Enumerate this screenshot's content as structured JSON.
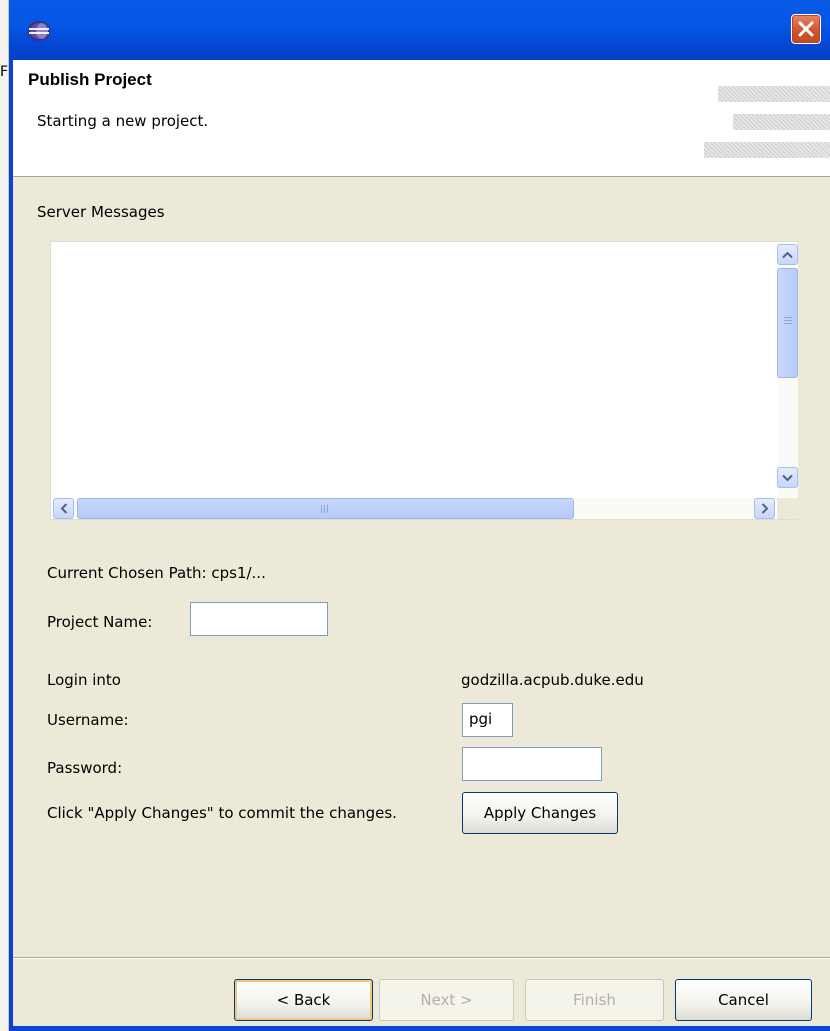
{
  "background_fragment": "F",
  "dialog": {
    "header": {
      "title": "Publish Project",
      "description": "Starting a new project."
    },
    "server_messages_label": "Server Messages",
    "server_messages_content": "",
    "current_path_label": "Current Chosen Path: cps1/...",
    "project_name": {
      "label": "Project Name:",
      "value": ""
    },
    "login": {
      "label": "Login into",
      "host": "godzilla.acpub.duke.edu"
    },
    "username": {
      "label": "Username:",
      "value": "pgi"
    },
    "password": {
      "label": "Password:",
      "value": ""
    },
    "apply_hint": "Click \"Apply Changes\" to commit the changes.",
    "apply_button": "Apply Changes",
    "buttons": {
      "back": "< Back",
      "next": "Next >",
      "finish": "Finish",
      "cancel": "Cancel"
    }
  },
  "icons": {
    "app": "eclipse-icon",
    "close": "close-icon",
    "scroll_up": "chevron-up-icon",
    "scroll_down": "chevron-down-icon",
    "scroll_left": "chevron-left-icon",
    "scroll_right": "chevron-right-icon"
  },
  "colors": {
    "titlebar": "#0554e4",
    "close_button": "#d0542e",
    "dialog_background": "#ece9d8",
    "scrollbar": "#c6d6fb"
  },
  "state": {
    "next_enabled": false,
    "finish_enabled": false,
    "focused_button": "back"
  }
}
